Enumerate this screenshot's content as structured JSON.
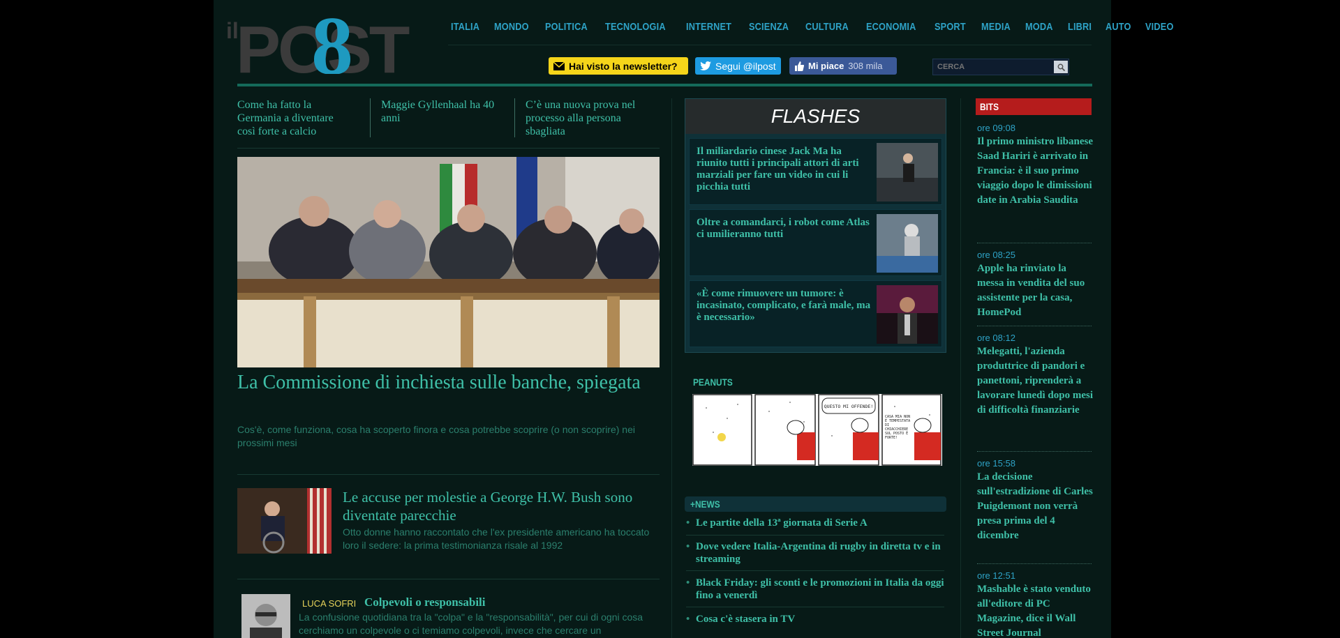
{
  "logo": {
    "prefix": "il",
    "name": "POST"
  },
  "nav": [
    "ITALIA",
    "MONDO",
    "POLITICA",
    "TECNOLOGIA",
    "INTERNET",
    "SCIENZA",
    "CULTURA",
    "ECONOMIA",
    "SPORT",
    "MEDIA",
    "MODA",
    "LIBRI",
    "AUTO",
    "VIDEO"
  ],
  "social": {
    "newsletter": "Hai visto la newsletter?",
    "twitter": "Segui @ilpost",
    "like": "Mi piace",
    "like_count": "308 mila"
  },
  "search": {
    "placeholder": "CERCA"
  },
  "top_links": [
    "Come ha fatto la Germania a diventare così forte a calcio",
    "Maggie Gyllenhaal ha 40 anni",
    "C’è una nuova prova nel processo alla persona sbagliata"
  ],
  "hero": {
    "title": "La Commissione di inchiesta sulle banche, spiegata",
    "subtitle": "Cos'è, come funziona, cosa ha scoperto finora e cosa potrebbe scoprire (o non scoprire) nei prossimi mesi"
  },
  "story2": {
    "title": "Le accuse per molestie a George H.W. Bush sono diventate parecchie",
    "subtitle": "Otto donne hanno raccontato che l'ex presidente americano ha toccato loro il sedere: la prima testimonianza risale al 1992"
  },
  "story3": {
    "author": "LUCA SOFRI",
    "title": "Colpevoli o responsabili",
    "subtitle": "La confusione quotidiana tra la \"colpa\" e la \"responsabilità\", per cui di ogni cosa cerchiamo un colpevole o ci temiamo colpevoli, invece che cercare un"
  },
  "flashes": {
    "label": "FLASHES",
    "items": [
      "Il miliardario cinese Jack Ma ha riunito tutti i principali attori di arti marziali per fare un video in cui li picchia tutti",
      "Oltre a comandarci, i robot come Atlas ci umilieranno tutti",
      "«È come rimuovere un tumore: è incasinato, complicato, e farà male, ma è necessario»"
    ]
  },
  "peanuts": {
    "label": "PEANUTS",
    "bubble1": "QUESTO MI OFFENDE!",
    "bubble2": "CASA MIA NON È TEMPESTATA DI CHIACCHIERE SUL POSTO È FORTE!"
  },
  "news": {
    "label": "+NEWS",
    "items": [
      "Le partite della 13ª giornata di Serie A",
      "Dove vedere Italia-Argentina di rugby in diretta tv e in streaming",
      "Black Friday: gli sconti e le promozioni in Italia da oggi fino a venerdì",
      "Cosa c'è stasera in TV"
    ]
  },
  "bits": {
    "label": "BITS",
    "items": [
      {
        "time": "ore 09:08",
        "text": "Il primo ministro libanese Saad Hariri è arrivato in Francia: è il suo primo viaggio dopo le dimissioni date in Arabia Saudita"
      },
      {
        "time": "ore 08:25",
        "text": "Apple ha rinviato la messa in vendita del suo assistente per la casa, HomePod"
      },
      {
        "time": "ore 08:12",
        "text": "Melegatti, l'azienda produttrice di pandori e panettoni, riprenderà a lavorare lunedì dopo mesi di difficoltà finanziarie"
      },
      {
        "time": "ore 15:58",
        "text": "La decisione sull'estradizione di Carles Puigdemont non verrà presa prima del 4 dicembre"
      },
      {
        "time": "ore 12:51",
        "text": "Mashable è stato venduto all'editore di PC Magazine, dice il Wall Street Journal"
      }
    ]
  },
  "colors": {
    "accent": "#3fc0a8",
    "nav": "#2ea3c7",
    "bits_red": "#b51c1c",
    "newsletter_yellow": "#f5d51a"
  }
}
